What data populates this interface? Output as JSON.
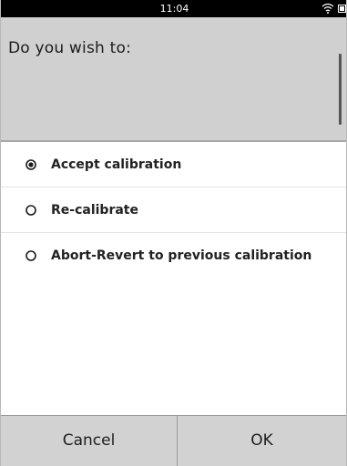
{
  "status_bar": {
    "time": "11:04",
    "wifi_icon": "wifi-icon",
    "battery_icon": "battery-icon"
  },
  "prompt": {
    "text": "Do you wish to:"
  },
  "options": [
    {
      "label": "Accept calibration",
      "selected": true
    },
    {
      "label": "Re-calibrate",
      "selected": false
    },
    {
      "label": "Abort-Revert to previous calibration",
      "selected": false
    }
  ],
  "buttons": {
    "cancel_label": "Cancel",
    "ok_label": "OK"
  },
  "colors": {
    "status_bar_bg": "#000000",
    "prompt_bg": "#d0d0d0",
    "button_bar_bg": "#d2d2d2"
  }
}
